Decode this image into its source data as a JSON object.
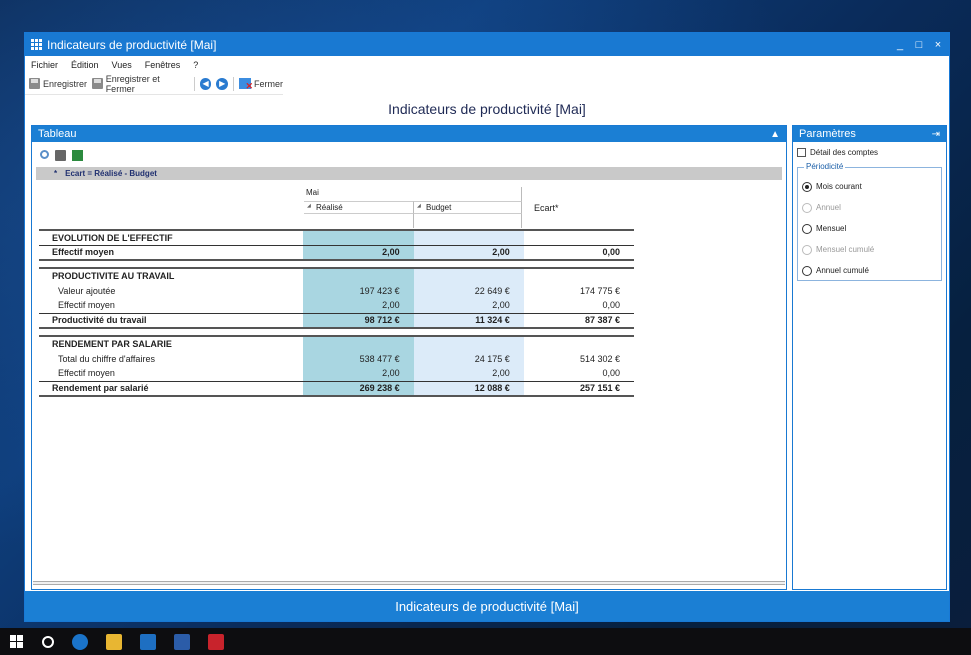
{
  "window": {
    "title": "Indicateurs de productivité [Mai]",
    "controls": [
      "_",
      "□",
      "×"
    ]
  },
  "menu": [
    "Fichier",
    "Édition",
    "Vues",
    "Fenêtres",
    "?"
  ],
  "toolbar": {
    "save": "Enregistrer",
    "save_close": "Enregistrer et Fermer",
    "back": "◀",
    "forward": "▶",
    "close": "Fermer"
  },
  "heading": "Indicateurs de productivité [Mai]",
  "tableau": {
    "title": "Tableau",
    "formula": "Ecart = Réalisé - Budget",
    "formula_bullet": "*",
    "col_group": "Mai",
    "col_realise": "Réalisé",
    "col_budget": "Budget",
    "col_ecart": "Ecart*",
    "rows": [
      {
        "type": "sec",
        "label": "EVOLUTION DE L'EFFECTIF",
        "v1": "",
        "v2": "",
        "v3": ""
      },
      {
        "type": "tot",
        "label": "Effectif moyen",
        "v1": "2,00",
        "v2": "2,00",
        "v3": "0,00"
      },
      {
        "type": "gap"
      },
      {
        "type": "sec",
        "label": "PRODUCTIVITE AU TRAVAIL",
        "v1": "",
        "v2": "",
        "v3": ""
      },
      {
        "type": "sub",
        "label": "Valeur ajoutée",
        "v1": "197 423 €",
        "v2": "22 649 €",
        "v3": "174 775 €"
      },
      {
        "type": "sub",
        "label": "Effectif moyen",
        "v1": "2,00",
        "v2": "2,00",
        "v3": "0,00"
      },
      {
        "type": "tot",
        "label": "Productivité du travail",
        "v1": "98 712 €",
        "v2": "11 324 €",
        "v3": "87 387 €"
      },
      {
        "type": "gap"
      },
      {
        "type": "sec",
        "label": "RENDEMENT PAR SALARIE",
        "v1": "",
        "v2": "",
        "v3": ""
      },
      {
        "type": "sub",
        "label": "Total du chiffre d'affaires",
        "v1": "538 477 €",
        "v2": "24 175 €",
        "v3": "514 302 €"
      },
      {
        "type": "sub",
        "label": "Effectif moyen",
        "v1": "2,00",
        "v2": "2,00",
        "v3": "0,00"
      },
      {
        "type": "tot",
        "label": "Rendement par salarié",
        "v1": "269 238 €",
        "v2": "12 088 €",
        "v3": "257 151 €"
      }
    ]
  },
  "parametres": {
    "title": "Paramètres",
    "detail_label": "Détail des comptes",
    "periodicite_title": "Périodicité",
    "options": [
      {
        "label": "Mois courant",
        "selected": true,
        "enabled": true
      },
      {
        "label": "Annuel",
        "selected": false,
        "enabled": false
      },
      {
        "label": "Mensuel",
        "selected": false,
        "enabled": true
      },
      {
        "label": "Mensuel cumulé",
        "selected": false,
        "enabled": false
      },
      {
        "label": "Annuel cumulé",
        "selected": false,
        "enabled": true
      }
    ]
  },
  "statusbar": "Indicateurs de productivité [Mai]",
  "taskbar_icons": [
    "windows-start-icon",
    "cortana-search-icon",
    "edge-icon",
    "file-explorer-icon",
    "outlook-icon",
    "word-icon",
    "app-icon"
  ],
  "colors": {
    "accent": "#1979d2",
    "realise": "#a9d6e1",
    "budget": "#dcebf9"
  }
}
